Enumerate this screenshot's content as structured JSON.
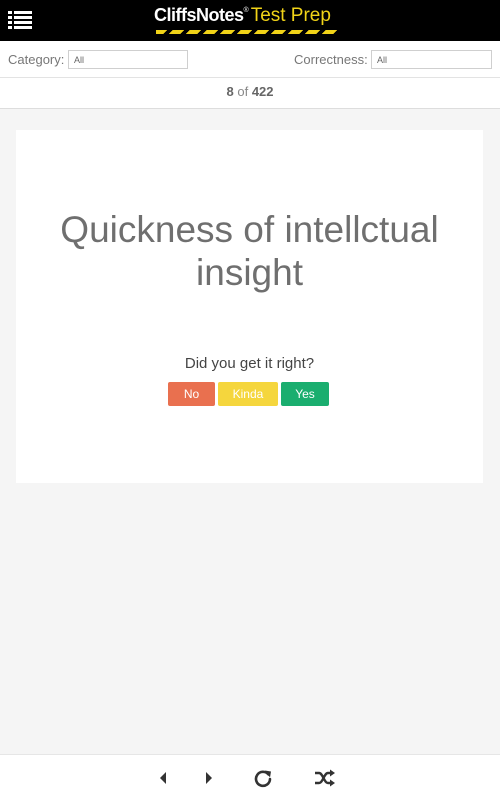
{
  "header": {
    "logo_brand": "CliffsNotes",
    "logo_reg": "®",
    "logo_sub": "Test Prep",
    "icons": {
      "menu": "menu-list-icon"
    }
  },
  "filters": {
    "category_label": "Category:",
    "category_value": "All",
    "correctness_label": "Correctness:",
    "correctness_value": "All"
  },
  "counter": {
    "current": "8",
    "of": "of",
    "total": "422"
  },
  "card": {
    "term": "Quickness of intellctual insight",
    "prompt": "Did you get it right?",
    "buttons": {
      "no": "No",
      "kinda": "Kinda",
      "yes": "Yes"
    }
  },
  "footer": {
    "icons": [
      "previous-arrow-icon",
      "next-arrow-icon",
      "refresh-icon",
      "shuffle-icon"
    ]
  },
  "colors": {
    "header_bg": "#000000",
    "brand_accent": "#f1d318",
    "no": "#e9704f",
    "kinda": "#f5d63d",
    "yes": "#1aae6f"
  }
}
